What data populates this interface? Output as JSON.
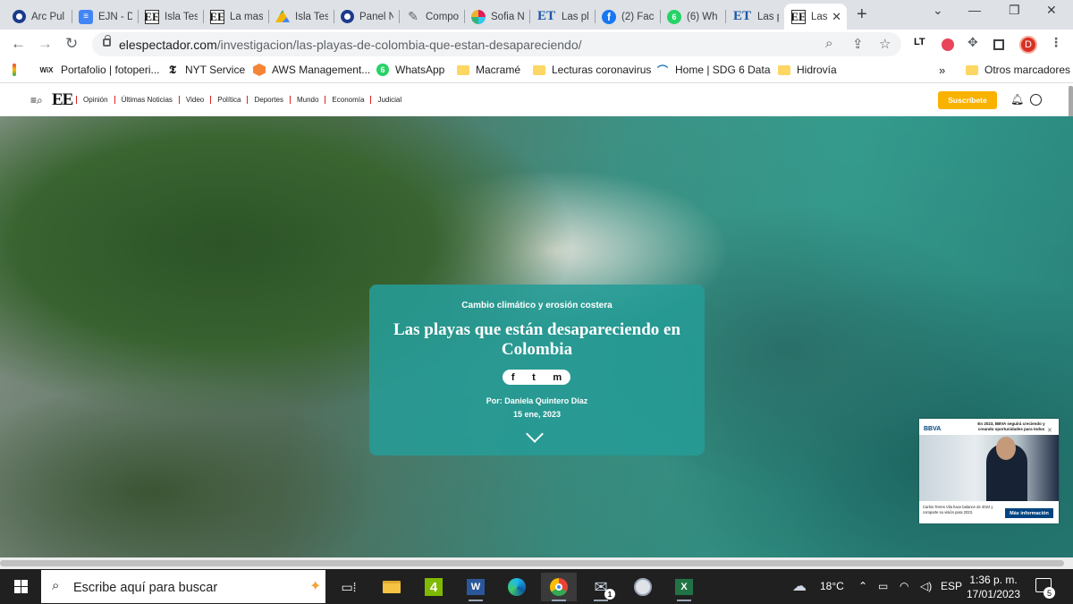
{
  "browser": {
    "tabs": [
      {
        "title": "Arc Pul",
        "icon": "arc-icon"
      },
      {
        "title": "EJN - D",
        "icon": "google-docs-icon"
      },
      {
        "title": "Isla Tes",
        "icon": "el-espectador-icon"
      },
      {
        "title": "La mas",
        "icon": "el-espectador-icon"
      },
      {
        "title": "Isla Tes",
        "icon": "google-drive-icon"
      },
      {
        "title": "Panel N",
        "icon": "arc-icon"
      },
      {
        "title": "Compo",
        "icon": "pencil-icon"
      },
      {
        "title": "Sofia N",
        "icon": "slack-icon"
      },
      {
        "title": "Las pla",
        "icon": "el-tiempo-icon"
      },
      {
        "title": "(2) Face",
        "icon": "facebook-icon"
      },
      {
        "title": "(6) Wh",
        "icon": "whatsapp-icon"
      },
      {
        "title": "Las pla",
        "icon": "el-tiempo-icon"
      },
      {
        "title": "Las",
        "icon": "el-espectador-icon",
        "active": true
      }
    ],
    "url_host": "elespectador.com",
    "url_path": "/investigacion/las-playas-de-colombia-que-estan-desapareciendo/",
    "profile_initial": "D",
    "bookmarks": [
      {
        "label": "",
        "icon": "google-apps-icon"
      },
      {
        "label": "Portafolio | fotoperi...",
        "icon": "wix-icon"
      },
      {
        "label": "NYT Service",
        "icon": "nyt-icon"
      },
      {
        "label": "AWS Management...",
        "icon": "aws-icon"
      },
      {
        "label": "WhatsApp",
        "icon": "whatsapp-icon"
      },
      {
        "label": "Macramé",
        "icon": "folder-icon"
      },
      {
        "label": "Lecturas coronavirus",
        "icon": "folder-icon"
      },
      {
        "label": "Home | SDG 6 Data",
        "icon": "un-water-icon"
      },
      {
        "label": "Hidrovía",
        "icon": "folder-icon"
      }
    ],
    "bookmarks_overflow": "»",
    "other_bookmarks": "Otros marcadores"
  },
  "site": {
    "logo": "EE",
    "sections": [
      "Opinión",
      "Últimas Noticias",
      "Video",
      "Política",
      "Deportes",
      "Mundo",
      "Economía",
      "Judicial"
    ],
    "subscribe_label": "Suscríbete"
  },
  "article": {
    "kicker": "Cambio climático y erosión costera",
    "headline": "Las playas que están desapareciendo en Colombia",
    "share": [
      "f",
      "t",
      "m"
    ],
    "byline": "Por: Daniela Quintero Díaz",
    "date": "15 ene, 2023"
  },
  "ad": {
    "brand": "BBVA",
    "headline": "En 2023, BBVA seguirá creciendo y creando oportunidades para todos",
    "caption": "Carlos Torres Vila hace balance de 2022 y comparte su visión para 2023.",
    "cta": "Más información"
  },
  "taskbar": {
    "search_placeholder": "Escribe aquí para buscar",
    "weather": "18°C",
    "language": "ESP",
    "time": "1:36 p. m.",
    "date": "17/01/2023",
    "notifications": "5",
    "mail_badge": "1",
    "four_label": "4"
  }
}
